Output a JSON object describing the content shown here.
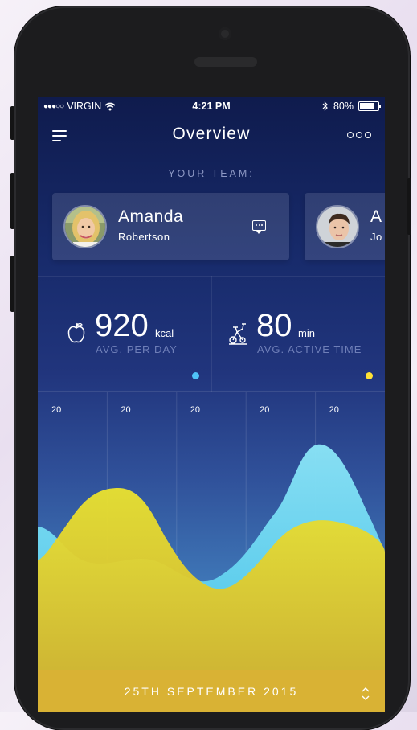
{
  "status": {
    "carrier": "VIRGIN",
    "time": "4:21 PM",
    "battery": "80%",
    "signal_icon": "signal-dots-icon",
    "wifi_icon": "wifi-icon",
    "bluetooth_icon": "bluetooth-icon"
  },
  "nav": {
    "title": "Overview"
  },
  "team": {
    "label": "YOUR TEAM:",
    "members": [
      {
        "first": "Amanda",
        "last": "Robertson"
      },
      {
        "first": "A",
        "last": "Jo"
      }
    ]
  },
  "stats": [
    {
      "value": "920",
      "unit": "kcal",
      "caption": "AVG. PER DAY",
      "icon": "apple-icon",
      "accent": "#4fc3f7"
    },
    {
      "value": "80",
      "unit": "min",
      "caption": "AVG. ACTIVE TIME",
      "icon": "exercise-bike-icon",
      "accent": "#ffe135"
    }
  ],
  "chart_data": {
    "type": "area",
    "column_labels": [
      "20",
      "20",
      "20",
      "20",
      "20"
    ],
    "series": [
      {
        "color": "#7fdcf3"
      },
      {
        "color": "#e3d82c"
      }
    ]
  },
  "footer": {
    "date": "25TH SEPTEMBER 2015"
  },
  "colors": {
    "background_top": "#0f1b4d",
    "background_bottom": "#5aa6d8",
    "footer": "#d9b234"
  }
}
